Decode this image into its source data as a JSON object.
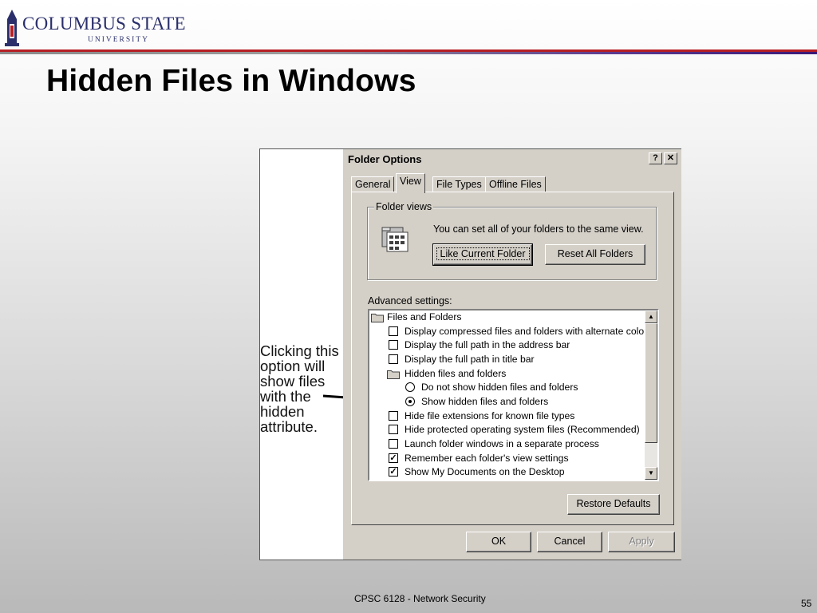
{
  "slide": {
    "logo_name": "COLUMBUS STATE",
    "logo_sub": "UNIVERSITY",
    "title": "Hidden Files in Windows",
    "footer": "CPSC 6128 - Network Security",
    "page_number": "55",
    "colors": {
      "accent_red": "#b51f24",
      "accent_purple": "#3a1a78",
      "logo_navy": "#2a2f6b"
    }
  },
  "figure": {
    "caption": "Clicking this option will show files with the hidden attribute."
  },
  "dialog": {
    "title": "Folder Options",
    "help_button": "?",
    "close_button": "✕",
    "tabs": [
      {
        "label": "General",
        "active": false
      },
      {
        "label": "View",
        "active": true
      },
      {
        "label": "File Types",
        "active": false
      },
      {
        "label": "Offline Files",
        "active": false
      }
    ],
    "folder_views": {
      "legend": "Folder views",
      "description": "You can set all of your folders to the same view.",
      "like_current_label": "Like Current Folder",
      "reset_all_label": "Reset All Folders"
    },
    "advanced_label": "Advanced settings:",
    "tree": [
      {
        "type": "folder",
        "label": "Files and Folders",
        "indent": 0
      },
      {
        "type": "checkbox",
        "label": "Display compressed files and folders with alternate color",
        "checked": false,
        "indent": 1
      },
      {
        "type": "checkbox",
        "label": "Display the full path in the address bar",
        "checked": false,
        "indent": 1
      },
      {
        "type": "checkbox",
        "label": "Display the full path in title bar",
        "checked": false,
        "indent": 1
      },
      {
        "type": "folder",
        "label": "Hidden files and folders",
        "indent": 1
      },
      {
        "type": "radio",
        "label": "Do not show hidden files and folders",
        "checked": false,
        "indent": 2
      },
      {
        "type": "radio",
        "label": "Show hidden files and folders",
        "checked": true,
        "indent": 2
      },
      {
        "type": "checkbox",
        "label": "Hide file extensions for known file types",
        "checked": false,
        "indent": 1
      },
      {
        "type": "checkbox",
        "label": "Hide protected operating system files (Recommended)",
        "checked": false,
        "indent": 1
      },
      {
        "type": "checkbox",
        "label": "Launch folder windows in a separate process",
        "checked": false,
        "indent": 1
      },
      {
        "type": "checkbox",
        "label": "Remember each folder's view settings",
        "checked": true,
        "indent": 1
      },
      {
        "type": "checkbox",
        "label": "Show My Documents on the Desktop",
        "checked": true,
        "indent": 1
      }
    ],
    "restore_defaults_label": "Restore Defaults",
    "ok_label": "OK",
    "cancel_label": "Cancel",
    "apply_label": "Apply",
    "apply_enabled": false
  }
}
